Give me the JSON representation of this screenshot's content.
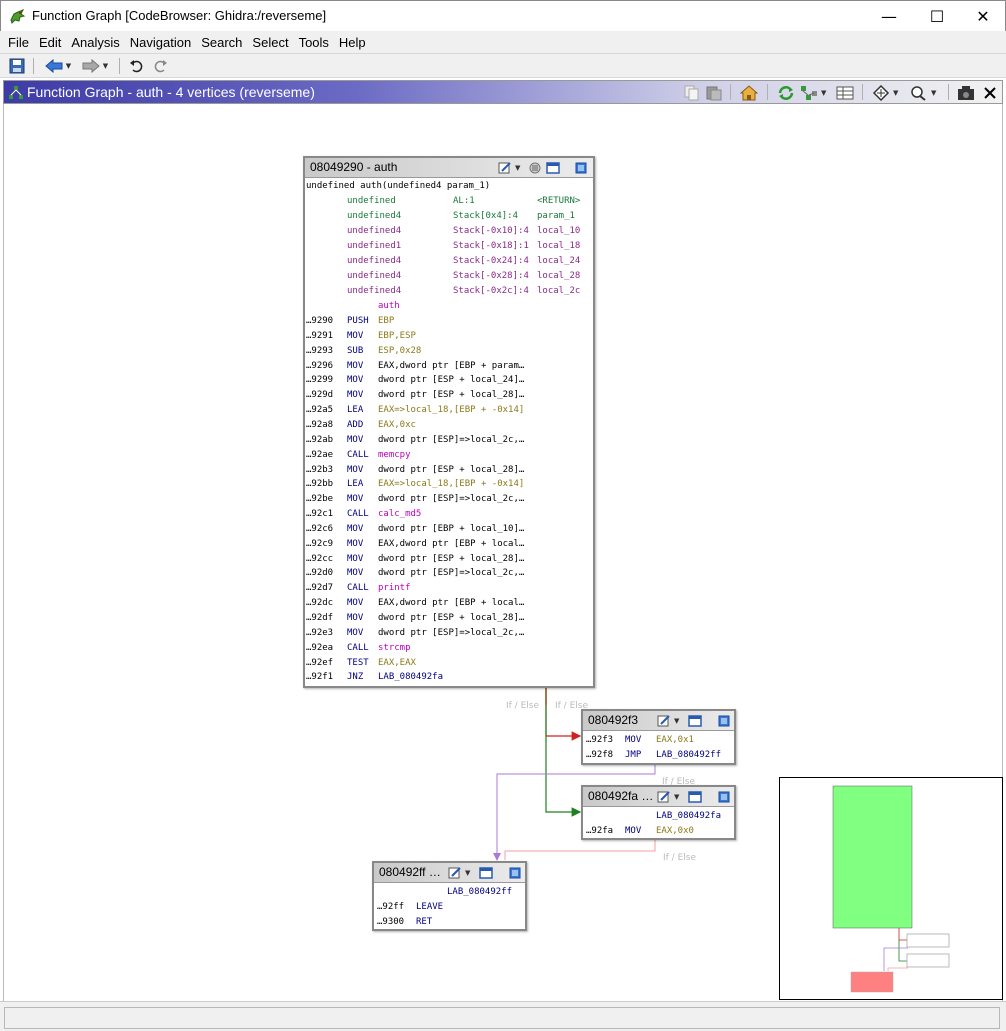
{
  "window": {
    "title": "Function Graph [CodeBrowser: Ghidra:/reverseme]",
    "minimize": "—",
    "maximize": "☐",
    "close": "✕"
  },
  "menus": [
    "File",
    "Edit",
    "Analysis",
    "Navigation",
    "Search",
    "Select",
    "Tools",
    "Help"
  ],
  "provider": {
    "title": "Function Graph - auth - 4 vertices  (reverseme)"
  },
  "vertices": {
    "main": {
      "title": "08049290 - auth",
      "signature": "undefined auth(undefined4 param_1)",
      "vars": [
        {
          "type": "undefined",
          "loc": "AL:1",
          "name": "<RETURN>"
        },
        {
          "type": "undefined4",
          "loc": "Stack[0x4]:4",
          "name": "param_1"
        },
        {
          "type": "undefined4",
          "loc": "Stack[-0x10]:4",
          "name": "local_10"
        },
        {
          "type": "undefined1",
          "loc": "Stack[-0x18]:1",
          "name": "local_18"
        },
        {
          "type": "undefined4",
          "loc": "Stack[-0x24]:4",
          "name": "local_24"
        },
        {
          "type": "undefined4",
          "loc": "Stack[-0x28]:4",
          "name": "local_28"
        },
        {
          "type": "undefined4",
          "loc": "Stack[-0x2c]:4",
          "name": "local_2c"
        }
      ],
      "label": "auth",
      "instructions": [
        {
          "addr": "…9290",
          "op": "PUSH",
          "args": "EBP"
        },
        {
          "addr": "…9291",
          "op": "MOV",
          "args": "EBP,ESP"
        },
        {
          "addr": "…9293",
          "op": "SUB",
          "args": "ESP,0x28"
        },
        {
          "addr": "…9296",
          "op": "MOV",
          "args": "EAX,dword ptr [EBP + param…"
        },
        {
          "addr": "…9299",
          "op": "MOV",
          "args": "dword ptr [ESP + local_24]…"
        },
        {
          "addr": "…929d",
          "op": "MOV",
          "args": "dword ptr [ESP + local_28]…"
        },
        {
          "addr": "…92a5",
          "op": "LEA",
          "args": "EAX=>local_18,[EBP + -0x14]"
        },
        {
          "addr": "…92a8",
          "op": "ADD",
          "args": "EAX,0xc"
        },
        {
          "addr": "…92ab",
          "op": "MOV",
          "args": "dword ptr [ESP]=>local_2c,…"
        },
        {
          "addr": "…92ae",
          "op": "CALL",
          "args": "memcpy"
        },
        {
          "addr": "…92b3",
          "op": "MOV",
          "args": "dword ptr [ESP + local_28]…"
        },
        {
          "addr": "…92bb",
          "op": "LEA",
          "args": "EAX=>local_18,[EBP + -0x14]"
        },
        {
          "addr": "…92be",
          "op": "MOV",
          "args": "dword ptr [ESP]=>local_2c,…"
        },
        {
          "addr": "…92c1",
          "op": "CALL",
          "args": "calc_md5"
        },
        {
          "addr": "…92c6",
          "op": "MOV",
          "args": "dword ptr [EBP + local_10]…"
        },
        {
          "addr": "…92c9",
          "op": "MOV",
          "args": "EAX,dword ptr [EBP + local…"
        },
        {
          "addr": "…92cc",
          "op": "MOV",
          "args": "dword ptr [ESP + local_28]…"
        },
        {
          "addr": "…92d0",
          "op": "MOV",
          "args": "dword ptr [ESP]=>local_2c,…"
        },
        {
          "addr": "…92d7",
          "op": "CALL",
          "args": "printf"
        },
        {
          "addr": "…92dc",
          "op": "MOV",
          "args": "EAX,dword ptr [EBP + local…"
        },
        {
          "addr": "…92df",
          "op": "MOV",
          "args": "dword ptr [ESP + local_28]…"
        },
        {
          "addr": "…92e3",
          "op": "MOV",
          "args": "dword ptr [ESP]=>local_2c,…"
        },
        {
          "addr": "…92ea",
          "op": "CALL",
          "args": "strcmp"
        },
        {
          "addr": "…92ef",
          "op": "TEST",
          "args": "EAX,EAX"
        },
        {
          "addr": "…92f1",
          "op": "JNZ",
          "args": "LAB_080492fa"
        }
      ]
    },
    "v92f3": {
      "title": "080492f3",
      "instructions": [
        {
          "addr": "…92f3",
          "op": "MOV",
          "args": "EAX,0x1"
        },
        {
          "addr": "…92f8",
          "op": "JMP",
          "args": "LAB_080492ff"
        }
      ]
    },
    "v92fa": {
      "title": "080492fa …",
      "label": "LAB_080492fa",
      "instructions": [
        {
          "addr": "…92fa",
          "op": "MOV",
          "args": "EAX,0x0"
        }
      ]
    },
    "v92ff": {
      "title": "080492ff …",
      "label": "LAB_080492ff",
      "instructions": [
        {
          "addr": "…92ff",
          "op": "LEAVE",
          "args": ""
        },
        {
          "addr": "…9300",
          "op": "RET",
          "args": ""
        }
      ]
    }
  },
  "edge_labels": [
    "If / Else",
    "If / Else",
    "If / Else",
    "If / Else"
  ],
  "colors": {
    "edge_false": "#d02020",
    "edge_true": "#208020",
    "edge_jump": "#a87bd8",
    "edge_fall": "#f0a0a0",
    "edge_main": "#8b4513",
    "satellite_entry": "#80ff80",
    "satellite_exit": "#ff8080"
  },
  "status": ""
}
